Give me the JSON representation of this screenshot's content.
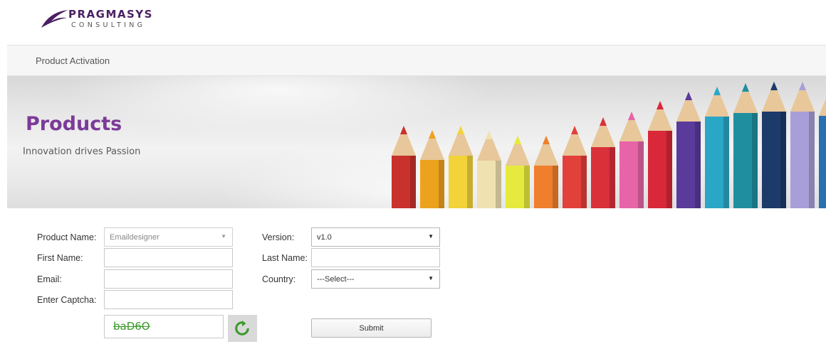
{
  "brand": {
    "name": "PRAGMASYS",
    "subtitle": "CONSULTING",
    "logo_icon": "swoosh-icon",
    "color": "#4b1f63"
  },
  "nav": {
    "items": [
      {
        "label": "Product Activation"
      }
    ]
  },
  "banner": {
    "title": "Products",
    "tagline": "Innovation drives Passion",
    "title_color": "#7b3a98"
  },
  "form": {
    "product_name": {
      "label": "Product Name:",
      "value": "Emaildesigner",
      "state": "disabled"
    },
    "version": {
      "label": "Version:",
      "value": "v1.0"
    },
    "first_name": {
      "label": "First Name:",
      "value": ""
    },
    "last_name": {
      "label": "Last Name:",
      "value": ""
    },
    "email": {
      "label": "Email:",
      "value": ""
    },
    "country": {
      "label": "Country:",
      "value": "---Select---"
    },
    "captcha": {
      "label": "Enter Captcha:",
      "value": "",
      "code": "baD6O",
      "code_color": "#3a9a2a",
      "refresh_icon": "refresh-icon"
    },
    "submit_label": "Submit"
  }
}
